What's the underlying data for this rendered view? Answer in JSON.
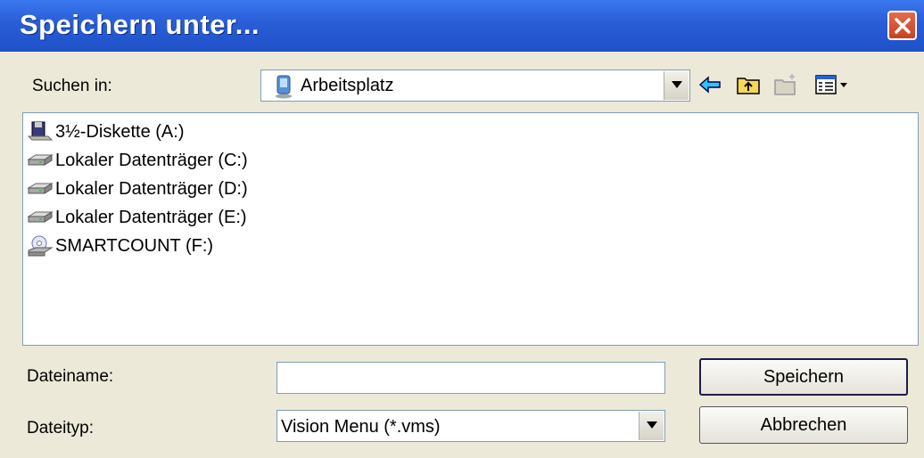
{
  "window": {
    "title": "Speichern unter..."
  },
  "lookin": {
    "label": "Suchen in:",
    "value": "Arbeitsplatz"
  },
  "toolbar": {
    "icons": [
      "back-arrow-icon",
      "up-folder-icon",
      "new-folder-icon",
      "view-menu-icon"
    ]
  },
  "files": [
    {
      "label": "3½-Diskette (A:)",
      "icon": "floppy-drive-icon"
    },
    {
      "label": "Lokaler Datenträger (C:)",
      "icon": "hard-drive-icon"
    },
    {
      "label": "Lokaler Datenträger (D:)",
      "icon": "hard-drive-icon"
    },
    {
      "label": "Lokaler Datenträger (E:)",
      "icon": "hard-drive-icon"
    },
    {
      "label": "SMARTCOUNT (F:)",
      "icon": "cd-drive-icon"
    }
  ],
  "filename": {
    "label": "Dateiname:",
    "value": ""
  },
  "filetype": {
    "label": "Dateityp:",
    "value": "Vision Menu (*.vms)"
  },
  "buttons": {
    "save": "Speichern",
    "cancel": "Abbrechen"
  },
  "colors": {
    "titlebar": "#2a5fd8",
    "dialog_bg": "#ece9d8",
    "close": "#d9532f"
  }
}
